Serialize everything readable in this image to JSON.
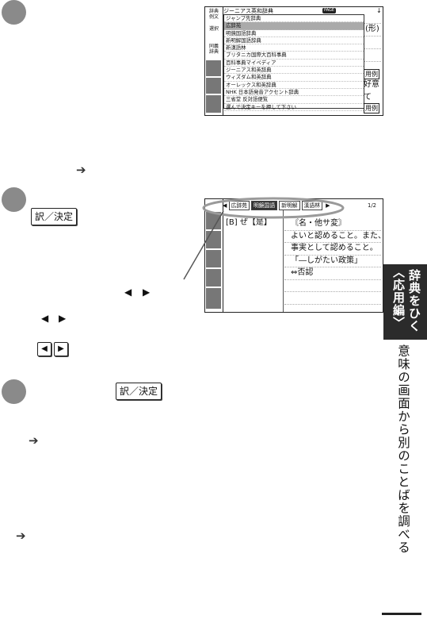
{
  "steps": {
    "s1": {
      "keys": []
    },
    "s2": {
      "keys": [
        {
          "label": "訳／決定"
        }
      ]
    },
    "s3": {
      "keys": [
        {
          "label": "訳／決定"
        }
      ]
    }
  },
  "arrows": {
    "a1": "➔",
    "a2": "➔",
    "a3": "➔"
  },
  "tri_pairs": {
    "left": "◀",
    "right": "▶"
  },
  "screen1": {
    "dict_title": "ジーニアス英和辞典",
    "badge": "PAGE",
    "side_icons": [
      "辞典\n例文",
      "選択",
      "同義\n辞典"
    ],
    "popup_items": [
      "ジャンプ先辞典",
      "広辞苑",
      "明鏡国語辞典",
      "新明解国語辞典",
      "新漢語林",
      "ブリタニカ国際大百科事典",
      "百科事典マイペディア",
      "ジーニアス和英辞典",
      "ウィズダム和英辞典",
      "オーレックス和英辞典",
      "NHK 日本語発音アクセント辞典",
      "三省堂 反対語便覧",
      "選んで決定キーを押して下さい"
    ],
    "popup_selected": 1,
    "right_words": [
      "(形)",
      "好意",
      "て"
    ],
    "right_boxes": [
      "用例",
      "用例"
    ]
  },
  "screen2": {
    "tabs": [
      "広辞苑",
      "明鏡国語",
      "新明解",
      "漢語林"
    ],
    "active_tab": 1,
    "page": "1/2",
    "headword": "[B] ぜ【是】",
    "definition": [
      "〘名・他サ変〙",
      "よいと認めること。また、",
      "事実として認めること。",
      "「―しがたい政策」",
      "⇔否認"
    ]
  },
  "sidebar": {
    "tab_lines": [
      "辞典をひく",
      "〈応用編〉"
    ],
    "vertical_title": "意味の画面から別のことばを調べる"
  }
}
